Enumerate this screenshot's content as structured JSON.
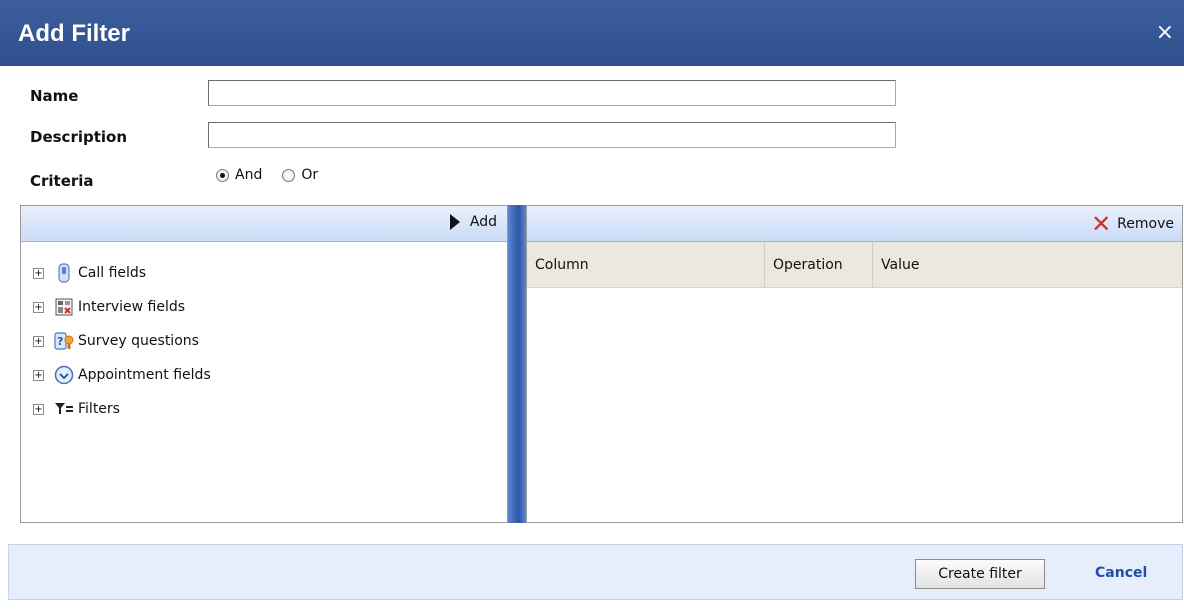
{
  "dialog": {
    "title": "Add Filter",
    "close_glyph": "×"
  },
  "form": {
    "name_label": "Name",
    "name_value": "",
    "description_label": "Description",
    "description_value": "",
    "criteria_label": "Criteria",
    "criteria_options": [
      "And",
      "Or"
    ],
    "criteria_selected": "And"
  },
  "left_panel": {
    "add_label": "Add",
    "tree": [
      {
        "label": "Call fields",
        "icon": "phone-icon",
        "expander": "+"
      },
      {
        "label": "Interview fields",
        "icon": "interview-icon",
        "expander": "+"
      },
      {
        "label": "Survey questions",
        "icon": "survey-icon",
        "expander": "+"
      },
      {
        "label": "Appointment fields",
        "icon": "clock-icon",
        "expander": "+"
      },
      {
        "label": "Filters",
        "icon": "filter-icon",
        "expander": "+"
      }
    ]
  },
  "right_panel": {
    "remove_label": "Remove",
    "columns": [
      "Column",
      "Operation",
      "Value"
    ]
  },
  "footer": {
    "create_label": "Create filter",
    "cancel_label": "Cancel"
  },
  "colors": {
    "titlebar": "#3a5a98",
    "splitter": "#3a63b5",
    "remove_icon": "#d0302a",
    "cancel_link": "#1f4fa8"
  }
}
